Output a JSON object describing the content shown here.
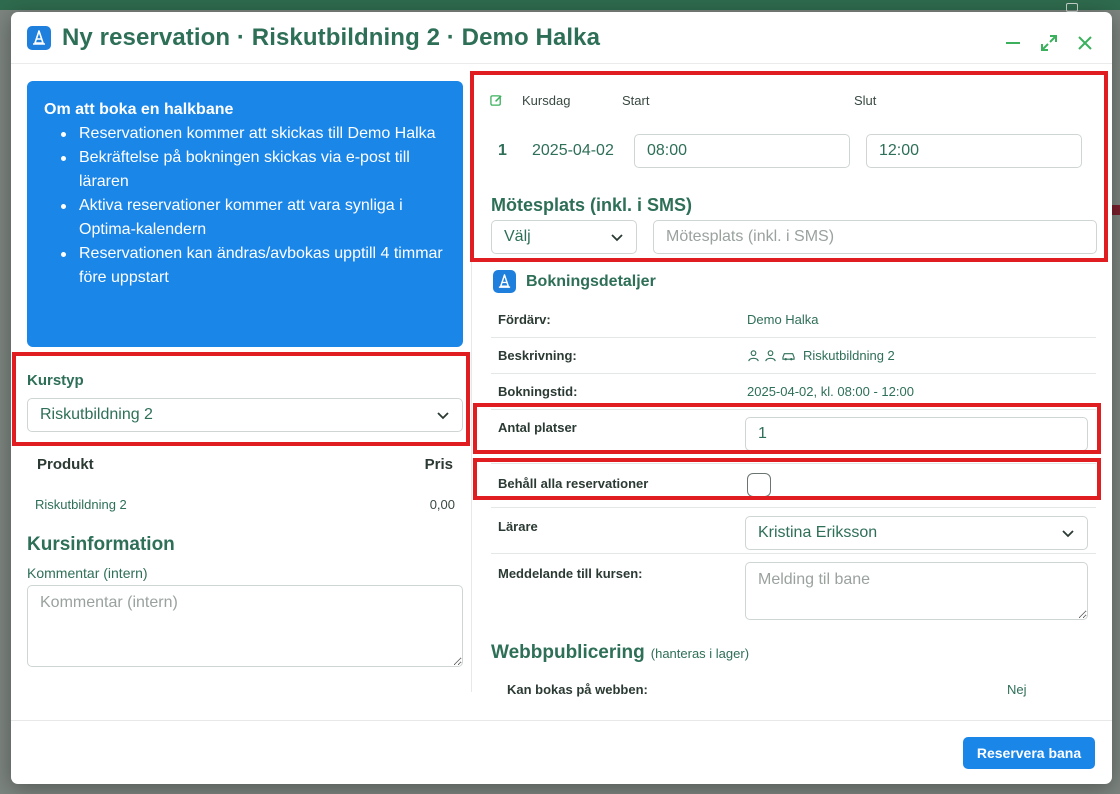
{
  "modal": {
    "title": "Ny reservation · Riskutbildning 2 · Demo Halka",
    "colors": {
      "accent": "#1a86e8",
      "title_green": "#2e6f57",
      "highlight": "#e01e22"
    },
    "icons": {
      "brand": "traffic-cone-icon",
      "minimize": "minus-icon",
      "maximize": "expand-icon",
      "close": "close-icon"
    }
  },
  "info": {
    "title": "Om att boka en halkbane",
    "items": [
      "Reservationen kommer att skickas till Demo Halka",
      "Bekräftelse på bokningen skickas via e-post till läraren",
      "Aktiva reservationer kommer att vara synliga i Optima-kalendern",
      "Reservationen kan ändras/avbokas upptill 4 timmar före uppstart"
    ]
  },
  "kurstyp": {
    "label": "Kurstyp",
    "value": "Riskutbildning 2"
  },
  "products": {
    "headers": {
      "product": "Produkt",
      "price": "Pris"
    },
    "rows": [
      {
        "name": "Riskutbildning 2",
        "price": "0,00"
      }
    ]
  },
  "kursinfo": {
    "title": "Kursinformation",
    "comment_label": "Kommentar (intern)",
    "comment_placeholder": "Kommentar (intern)"
  },
  "course_days": {
    "headers": {
      "day": "Kursdag",
      "start": "Start",
      "end": "Slut"
    },
    "rows": [
      {
        "num": "1",
        "date": "2025-04-02",
        "start": "08:00",
        "end": "12:00"
      }
    ]
  },
  "meeting": {
    "title": "Mötesplats (inkl. i SMS)",
    "select_value": "Välj",
    "placeholder": "Mötesplats (inkl. i SMS)"
  },
  "booking": {
    "title": "Bokningsdetaljer",
    "fordarv_label": "Fördärv:",
    "fordarv_value": "Demo Halka",
    "beskrivning_label": "Beskrivning:",
    "beskrivning_value": "Riskutbildning 2",
    "bokningstid_label": "Bokningstid:",
    "bokningstid_value": "2025-04-02, kl. 08:00 - 12:00",
    "antal_label": "Antal platser",
    "antal_value": "1",
    "behall_label": "Behåll alla reservationer",
    "behall_checked": false,
    "larare_label": "Lärare",
    "larare_value": "Kristina Eriksson",
    "meddelande_label": "Meddelande till kursen:",
    "meddelande_placeholder": "Melding til bane"
  },
  "web": {
    "title": "Webbpublicering",
    "subtitle": "(hanteras i lager)",
    "kan_bokas_label": "Kan bokas på webben:",
    "kan_bokas_value": "Nej"
  },
  "footer": {
    "submit_label": "Reservera bana"
  }
}
